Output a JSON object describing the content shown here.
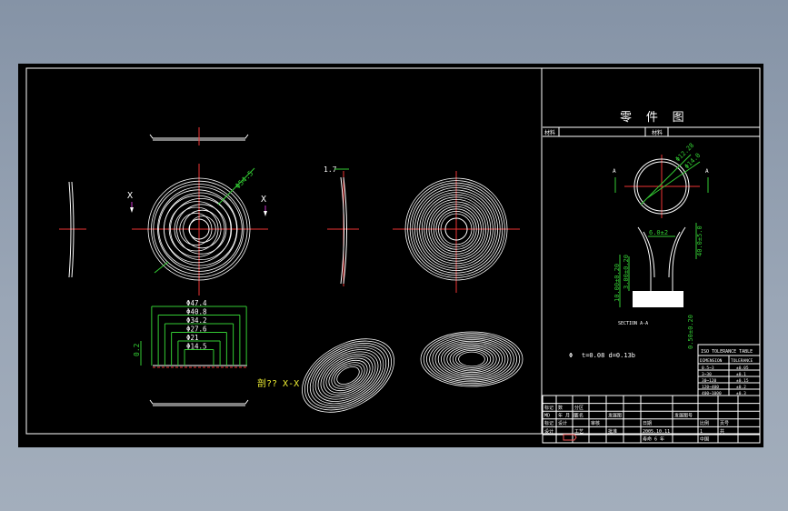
{
  "drawing": {
    "title_cn": "零 件 图",
    "header_left": "材料",
    "header_right": "材料",
    "section_label": "SECTION A-A",
    "section_x_label": "剖?? X-X",
    "x_marker": "X",
    "a_marker": "A",
    "dims_left": [
      "Φ47.4",
      "Φ40.8",
      "Φ34.2",
      "Φ27.6",
      "Φ21",
      "Φ14.5"
    ],
    "dim_thickness": "0.2",
    "dim_top_left": "1.7",
    "dim_circle_r": "Φ54.5",
    "detail_dims": [
      "Φ12.28",
      "Φ14.0",
      "6.0±2",
      "40.0±5.0",
      "10.00±0.20",
      "3.00±0.20",
      "0.50±0.20"
    ],
    "tolerance_note": "t=0.08 d=0.13b",
    "tolerance_note_prefix": "Φ",
    "iso_table": {
      "title": "ISO TOLERANCE TABLE",
      "headers": [
        "DIMENSION",
        "TOLERANCE"
      ],
      "rows": [
        [
          "0.5~3",
          "±0.05"
        ],
        [
          "3~30",
          "±0.1"
        ],
        [
          "30~120",
          "±0.15"
        ],
        [
          "120~400",
          "±0.2"
        ],
        [
          "400~1000",
          "±0.3"
        ]
      ]
    },
    "title_block": {
      "row1": [
        "",
        "",
        "",
        "",
        "",
        "",
        "",
        "",
        ""
      ],
      "row2": [
        "标记",
        "数",
        "分区",
        "",
        "",
        "",
        "",
        "",
        ""
      ],
      "row3": [
        "MD",
        "年 月 日",
        "签名",
        "",
        "发展图",
        "",
        "发展图号"
      ],
      "row4": [
        "标记",
        "设计",
        "",
        "审核",
        "",
        "日期",
        "",
        "比例",
        "页号"
      ],
      "row5": [
        "设计",
        "",
        "工艺",
        "",
        "批准",
        "2005.10.11",
        "",
        "1",
        "共"
      ],
      "row6": [
        "",
        "",
        "",
        "",
        "",
        "寿命 6 年",
        "",
        "中国"
      ]
    }
  }
}
